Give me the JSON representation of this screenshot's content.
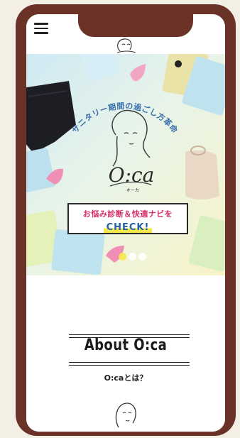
{
  "header": {
    "menu_icon": "hamburger-menu-icon",
    "logo_icon": "oca-logo-illustration"
  },
  "hero": {
    "arc_text": "サニタリー期間の過ごし方革命",
    "logo_text": "O:ca",
    "logo_small": "オーカ",
    "banner": {
      "line1": "お悩み診断＆快適ナビを",
      "line2": "CHECK!"
    },
    "carousel": {
      "total": 3,
      "active": 1
    }
  },
  "about": {
    "title": "About O:ca",
    "subtitle": "O:caとは？"
  },
  "colors": {
    "frame": "#6b3227",
    "accent_pink": "#d6306a",
    "accent_blue": "#2560a8",
    "highlight_yellow": "#f4e94a"
  }
}
